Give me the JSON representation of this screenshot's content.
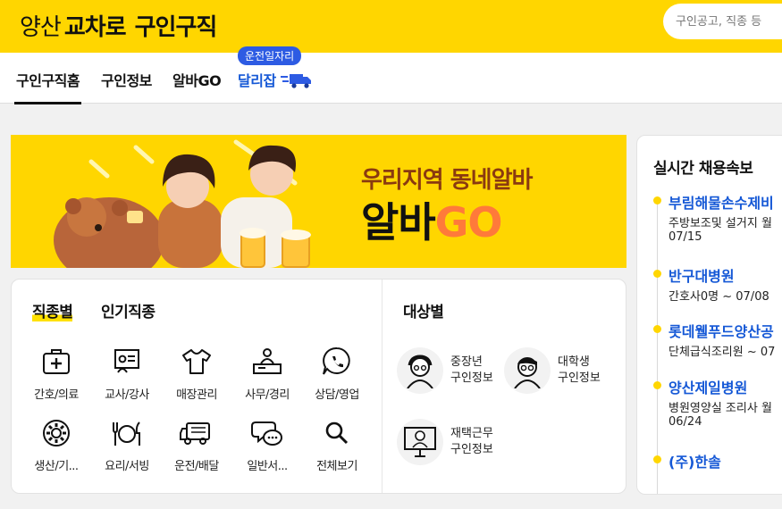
{
  "header": {
    "logo_region": "양산",
    "logo_brand": "교차로",
    "logo_sub": "구인구직",
    "search_placeholder": "구인공고, 직종 등"
  },
  "nav": {
    "items": [
      {
        "label": "구인구직홈",
        "active": true
      },
      {
        "label": "구인정보"
      },
      {
        "label": "알바GO"
      },
      {
        "label": "달리잡",
        "badge": "운전일자리"
      }
    ]
  },
  "banner": {
    "title": "우리지역 동네알바",
    "main_k": "알바",
    "main_go": "GO"
  },
  "categories": {
    "tabs": [
      "직종별",
      "인기직종"
    ],
    "items": [
      {
        "label": "간호/의료",
        "icon": "medical-kit-icon"
      },
      {
        "label": "교사/강사",
        "icon": "teacher-board-icon"
      },
      {
        "label": "매장관리",
        "icon": "shirt-icon"
      },
      {
        "label": "사무/경리",
        "icon": "office-desk-icon"
      },
      {
        "label": "상담/영업",
        "icon": "phone-chat-icon"
      },
      {
        "label": "생산/기...",
        "icon": "gear-icon"
      },
      {
        "label": "요리/서빙",
        "icon": "plate-utensils-icon"
      },
      {
        "label": "운전/배달",
        "icon": "delivery-truck-icon"
      },
      {
        "label": "일반서...",
        "icon": "speech-bubble-icon"
      },
      {
        "label": "전체보기",
        "icon": "search-icon"
      }
    ]
  },
  "targets": {
    "title": "대상별",
    "items": [
      {
        "line1": "중장년",
        "line2": "구인정보",
        "icon": "senior-avatar-icon"
      },
      {
        "line1": "대학생",
        "line2": "구인정보",
        "icon": "student-avatar-icon"
      },
      {
        "line1": "재택근무",
        "line2": "구인정보",
        "icon": "remote-work-avatar-icon"
      }
    ]
  },
  "realtime": {
    "title": "실시간 채용속보",
    "items": [
      {
        "company": "부림해물손수제비",
        "desc": "주방보조및 설거지 월",
        "date": "07/15"
      },
      {
        "company": "반구대병원",
        "desc": "간호사0명 ~ 07/08",
        "date": ""
      },
      {
        "company": "롯데웰푸드양산공",
        "desc": "단체급식조리원 ~ 07",
        "date": ""
      },
      {
        "company": "양산제일병원",
        "desc": "병원영양실 조리사 월",
        "date": "06/24"
      },
      {
        "company": "(주)한솔",
        "desc": "",
        "date": ""
      }
    ]
  },
  "colors": {
    "brand_yellow": "#ffd600",
    "link_blue": "#1558d6",
    "badge_blue": "#2d5be3"
  }
}
